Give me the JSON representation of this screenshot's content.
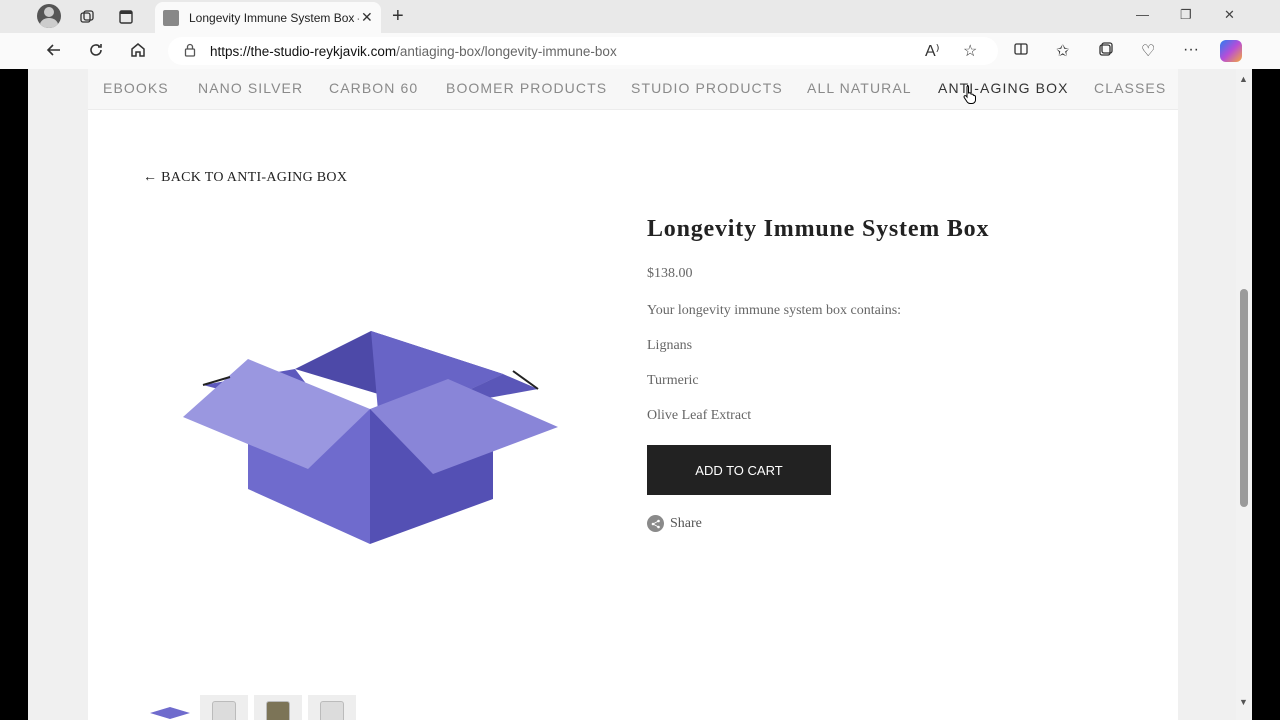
{
  "browser": {
    "tab_title": "Longevity Immune System Box —",
    "url_domain": "https://the-studio-reykjavik.com",
    "url_path": "/antiaging-box/longevity-immune-box"
  },
  "site_nav": {
    "items": [
      {
        "label": "EBOOKS"
      },
      {
        "label": "NANO SILVER"
      },
      {
        "label": "CARBON 60"
      },
      {
        "label": "BOOMER PRODUCTS"
      },
      {
        "label": "STUDIO PRODUCTS"
      },
      {
        "label": "ALL NATURAL"
      },
      {
        "label": "ANTI-AGING BOX"
      },
      {
        "label": "CLASSES"
      }
    ],
    "active": "ANTI-AGING BOX"
  },
  "product": {
    "back_link": "← BACK TO ANTI-AGING BOX",
    "title": "Longevity Immune System Box",
    "price": "$138.00",
    "description_intro": "Your longevity immune system box contains:",
    "contents": [
      "Lignans",
      "Turmeric",
      "Olive Leaf Extract"
    ],
    "add_to_cart_label": "ADD TO CART",
    "share_label": "Share"
  },
  "colors": {
    "box_purple": "#7b78cf",
    "box_dark": "#5a56b8",
    "button_bg": "#222222"
  }
}
